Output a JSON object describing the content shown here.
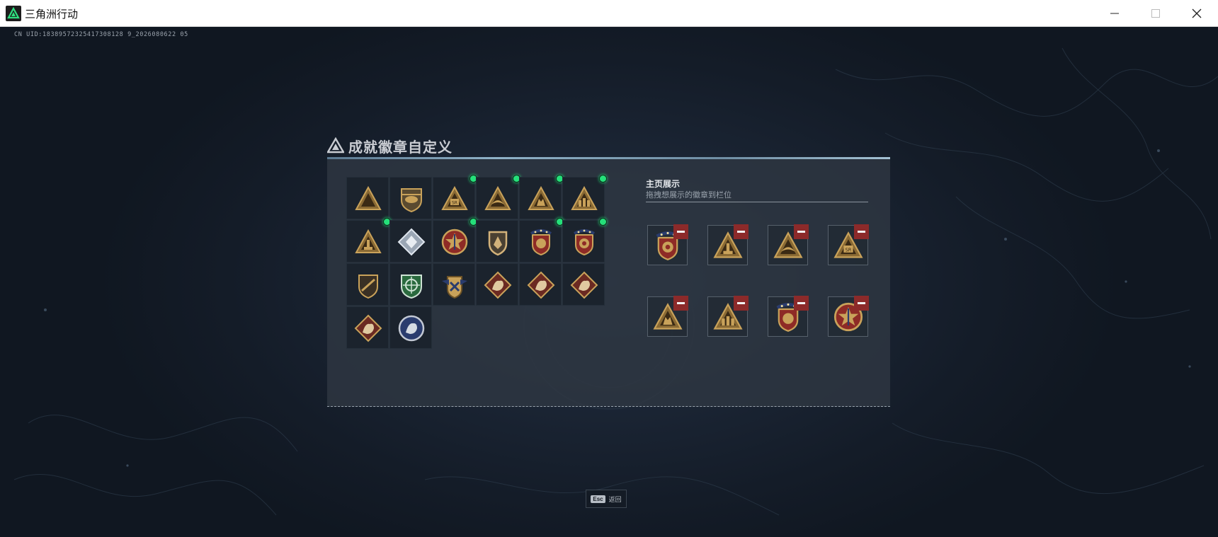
{
  "window": {
    "title": "三角洲行动",
    "buttons": [
      "minimize",
      "maximize",
      "close"
    ]
  },
  "uid_text": "CN UID:18389572325417308128 9_2026080622 05",
  "dialog": {
    "title": "成就徽章自定义",
    "badges": [
      {
        "icon": "shield-triangle-badge-icon",
        "new": false
      },
      {
        "icon": "helicopter-badge-icon",
        "new": false
      },
      {
        "icon": "sr-triangle-badge-icon",
        "new": true
      },
      {
        "icon": "bird-triangle-badge-icon",
        "new": true
      },
      {
        "icon": "wolf-triangle-badge-icon",
        "new": true
      },
      {
        "icon": "soldiers-triangle-badge-icon",
        "new": true
      },
      {
        "icon": "tower-triangle-badge-icon",
        "new": true
      },
      {
        "icon": "diamond-silver-badge-icon",
        "new": false
      },
      {
        "icon": "star-medal-badge-icon",
        "new": true
      },
      {
        "icon": "shield-gold-badge-icon",
        "new": false
      },
      {
        "icon": "red-crest-badge-icon",
        "new": true
      },
      {
        "icon": "red-crest-lion-badge-icon",
        "new": true
      },
      {
        "icon": "rifle-shield-badge-icon",
        "new": false
      },
      {
        "icon": "green-crosshair-badge-icon",
        "new": false
      },
      {
        "icon": "wings-crest-badge-icon",
        "new": false
      },
      {
        "icon": "wolf-diamond-badge-icon",
        "new": false
      },
      {
        "icon": "dragon-diamond-badge-icon",
        "new": false
      },
      {
        "icon": "dragon-diamond-2-badge-icon",
        "new": false
      },
      {
        "icon": "beast-diamond-badge-icon",
        "new": false
      },
      {
        "icon": "blue-round-badge-icon",
        "new": false
      }
    ],
    "showcase": {
      "title": "主页展示",
      "subtitle": "拖拽想展示的徽章到栏位",
      "slots": [
        {
          "icon": "red-crest-lion-badge-icon"
        },
        {
          "icon": "tower-triangle-badge-icon"
        },
        {
          "icon": "bird-triangle-badge-icon"
        },
        {
          "icon": "sr-triangle-badge-icon"
        },
        {
          "icon": "wolf-triangle-badge-icon"
        },
        {
          "icon": "soldiers-triangle-badge-icon"
        },
        {
          "icon": "red-crest-badge-icon"
        },
        {
          "icon": "star-medal-badge-icon"
        }
      ]
    }
  },
  "footer": {
    "key": "Esc",
    "label": "返回"
  },
  "colors": {
    "new_dot": "#25e07a",
    "remove_button": "#8c2a2a",
    "gold": "#c9a25a",
    "panel": "#2e3742"
  }
}
